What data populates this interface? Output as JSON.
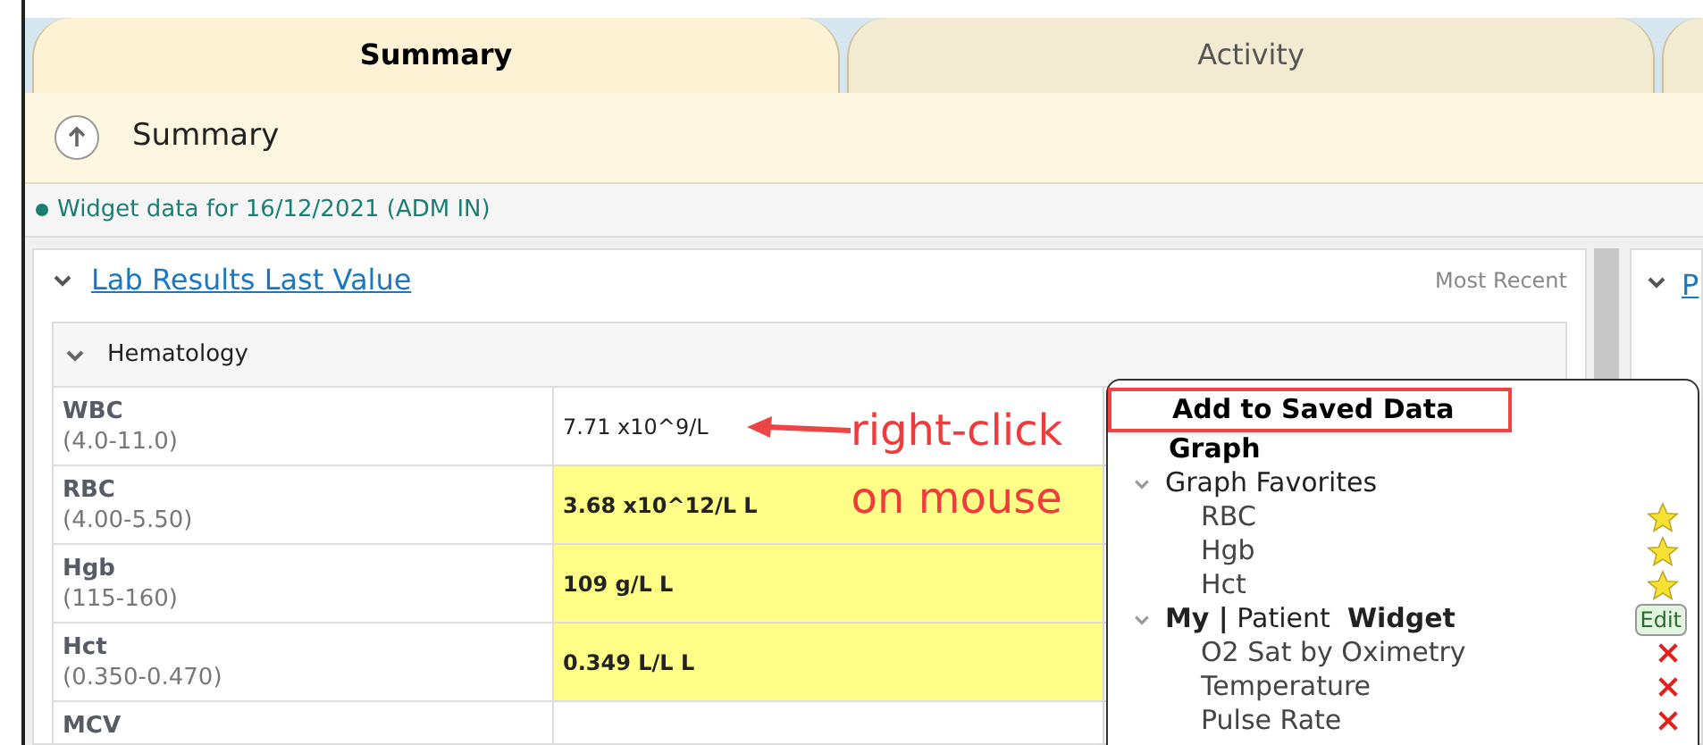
{
  "tabs": [
    {
      "label": "Summary",
      "selected": true
    },
    {
      "label": "Activity",
      "selected": false
    }
  ],
  "header": {
    "title": "Summary"
  },
  "widget_data": "Widget data for 16/12/2021 (ADM IN)",
  "lab_panel": {
    "title": "Lab Results Last Value",
    "sort": "Most Recent",
    "section": {
      "title": "Hematology",
      "expanded": true
    },
    "rows": [
      {
        "name": "WBC",
        "range": "(4.0-11.0)",
        "value": "7.71 x10^9/L",
        "abnormal": false
      },
      {
        "name": "RBC",
        "range": "(4.00-5.50)",
        "value": "3.68 x10^12/L L",
        "abnormal": true
      },
      {
        "name": "Hgb",
        "range": "(115-160)",
        "value": "109 g/L L",
        "abnormal": true
      },
      {
        "name": "Hct",
        "range": "(0.350-0.470)",
        "value": "0.349 L/L L",
        "abnormal": true
      },
      {
        "name": "MCV",
        "abnormal": false
      }
    ]
  },
  "right_panel": {
    "title": "P"
  },
  "annotation": {
    "lines": [
      "right-click",
      "on mouse"
    ]
  },
  "context_menu": {
    "items": [
      {
        "kind": "action",
        "label": "Add to Saved Data",
        "highlighted": true
      },
      {
        "kind": "action",
        "label": "Graph",
        "highlighted": false
      },
      {
        "kind": "group",
        "label": "Graph Favorites",
        "expanded": true,
        "children": [
          {
            "label": "RBC",
            "kind": "star"
          },
          {
            "label": "Hgb",
            "kind": "star"
          },
          {
            "label": "Hct",
            "kind": "star"
          }
        ]
      },
      {
        "kind": "group",
        "label": "**My |** Patient  **Widget**",
        "expanded": true,
        "button": "Edit",
        "children": [
          {
            "label": "O2 Sat by Oximetry",
            "kind": "remove"
          },
          {
            "label": "Temperature",
            "kind": "remove"
          },
          {
            "label": "Pulse Rate",
            "kind": "remove"
          }
        ]
      }
    ]
  }
}
